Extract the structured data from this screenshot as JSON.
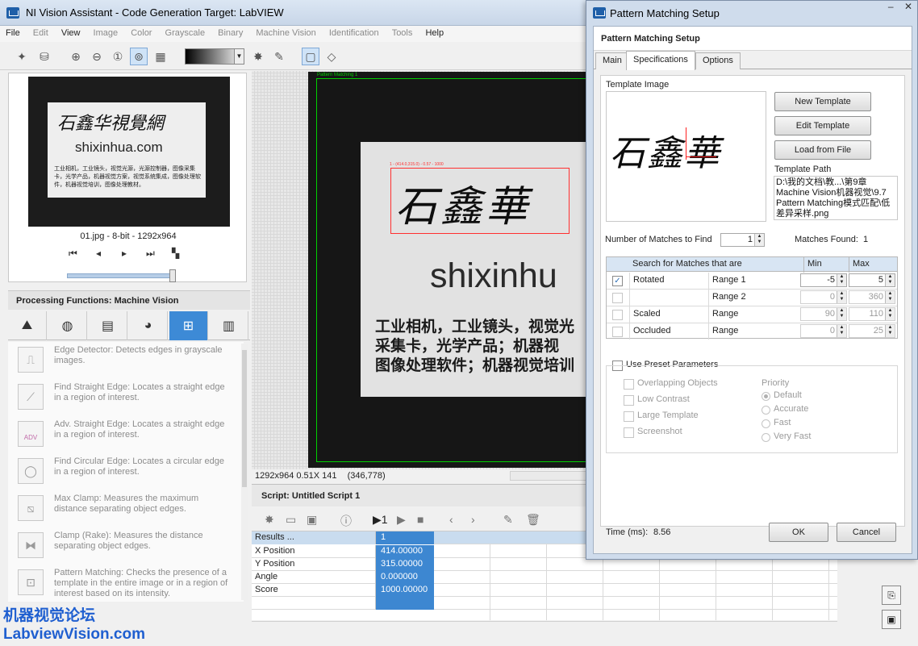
{
  "main_window": {
    "title": "NI Vision Assistant - Code Generation Target: LabVIEW",
    "menu": [
      "File",
      "Edit",
      "View",
      "Image",
      "Color",
      "Grayscale",
      "Binary",
      "Machine Vision",
      "Identification",
      "Tools",
      "Help"
    ]
  },
  "thumbnail": {
    "card_signature": "石鑫华視覺網",
    "card_url": "shixinhua.com",
    "card_text": "工业相机，工业镜头，视觉光源，光源控制器，图像采集卡，光学产品，机器视觉方案，视觉系统集成，图像处理软件，机器视觉培训，图像处理教材。",
    "label": "01.jpg - 8-bit - 1292x964"
  },
  "processing": {
    "header": "Processing Functions: Machine Vision",
    "functions": [
      {
        "icon": "edge-detector-icon",
        "text": "Edge Detector:  Detects edges in grayscale images."
      },
      {
        "icon": "find-straight-edge-icon",
        "text": "Find Straight Edge:  Locates a straight edge in a region of interest."
      },
      {
        "icon": "adv-straight-edge-icon",
        "text": "Adv. Straight Edge:  Locates a straight edge in a region of interest.",
        "badge": "ADV"
      },
      {
        "icon": "find-circular-edge-icon",
        "text": "Find Circular Edge:  Locates a circular edge in a region of interest."
      },
      {
        "icon": "max-clamp-icon",
        "text": "Max Clamp:  Measures the maximum distance separating object edges."
      },
      {
        "icon": "clamp-rake-icon",
        "text": "Clamp (Rake):  Measures the distance separating object edges."
      },
      {
        "icon": "pattern-matching-icon",
        "text": "Pattern Matching:  Checks the presence of a template in the entire image or in a region of interest based on its intensity."
      }
    ]
  },
  "watermark": {
    "line1": "机器视觉论坛",
    "line2": "LabviewVision.com"
  },
  "viewer": {
    "roi_label": "Pattern Matching 1",
    "match_label": "1 - (414.0,315.0) - 0.57 - 1000",
    "card_signature": "石鑫華",
    "card_url": "shixinhu",
    "card_text_lines": [
      "工业相机，工业镜头，视觉光",
      "采集卡，光学产品；机器视",
      "图像处理软件；机器视觉培训"
    ],
    "status_size": "1292x964 0.51X 141",
    "status_coord": "(346,778)"
  },
  "script": {
    "title": "Script: Untitled Script 1",
    "rows": [
      {
        "name": "Results ...",
        "value": "1"
      },
      {
        "name": "X Position",
        "value": "414.00000"
      },
      {
        "name": "Y Position",
        "value": "315.00000"
      },
      {
        "name": "Angle",
        "value": "0.000000"
      },
      {
        "name": "Score",
        "value": "1000.00000"
      }
    ]
  },
  "dialog": {
    "title": "Pattern Matching Setup",
    "header": "Pattern Matching Setup",
    "tabs": [
      "Main",
      "Specifications",
      "Options"
    ],
    "template_image_label": "Template Image",
    "template_signature": "石鑫華",
    "buttons": {
      "new_template": "New Template",
      "edit_template": "Edit Template",
      "load_from_file": "Load from File",
      "ok": "OK",
      "cancel": "Cancel"
    },
    "template_path_label": "Template Path",
    "template_path": "D:\\我的文档\\教...\\第9章 Machine Vision机器视觉\\9.7 Pattern Matching模式匹配\\低差异采样.png",
    "num_matches_label": "Number of Matches to Find",
    "num_matches_value": "1",
    "matches_found_label": "Matches Found:",
    "matches_found_value": "1",
    "search_table": {
      "headers": [
        "Search for Matches that are",
        "Min",
        "Max"
      ],
      "rows": [
        {
          "checked": true,
          "name": "Rotated",
          "range": "Range 1",
          "min": "-5",
          "max": "5"
        },
        {
          "checked": false,
          "name": "",
          "range": "Range 2",
          "min": "0",
          "max": "360"
        },
        {
          "checked": false,
          "name": "Scaled",
          "range": "Range",
          "min": "90",
          "max": "110"
        },
        {
          "checked": false,
          "name": "Occluded",
          "range": "Range",
          "min": "0",
          "max": "25"
        }
      ]
    },
    "use_preset_label": "Use Preset Parameters",
    "preset_options": [
      "Overlapping Objects",
      "Low Contrast",
      "Large Template",
      "Screenshot"
    ],
    "priority_label": "Priority",
    "priority_options": [
      "Default",
      "Accurate",
      "Fast",
      "Very Fast"
    ],
    "priority_selected": "Default",
    "time_label": "Time (ms):",
    "time_value": "8.56"
  },
  "colors": {
    "accent": "#3d87d1",
    "roi_green": "#00d000",
    "match_red": "#ff3030",
    "watermark_blue": "#1f5fd0"
  }
}
